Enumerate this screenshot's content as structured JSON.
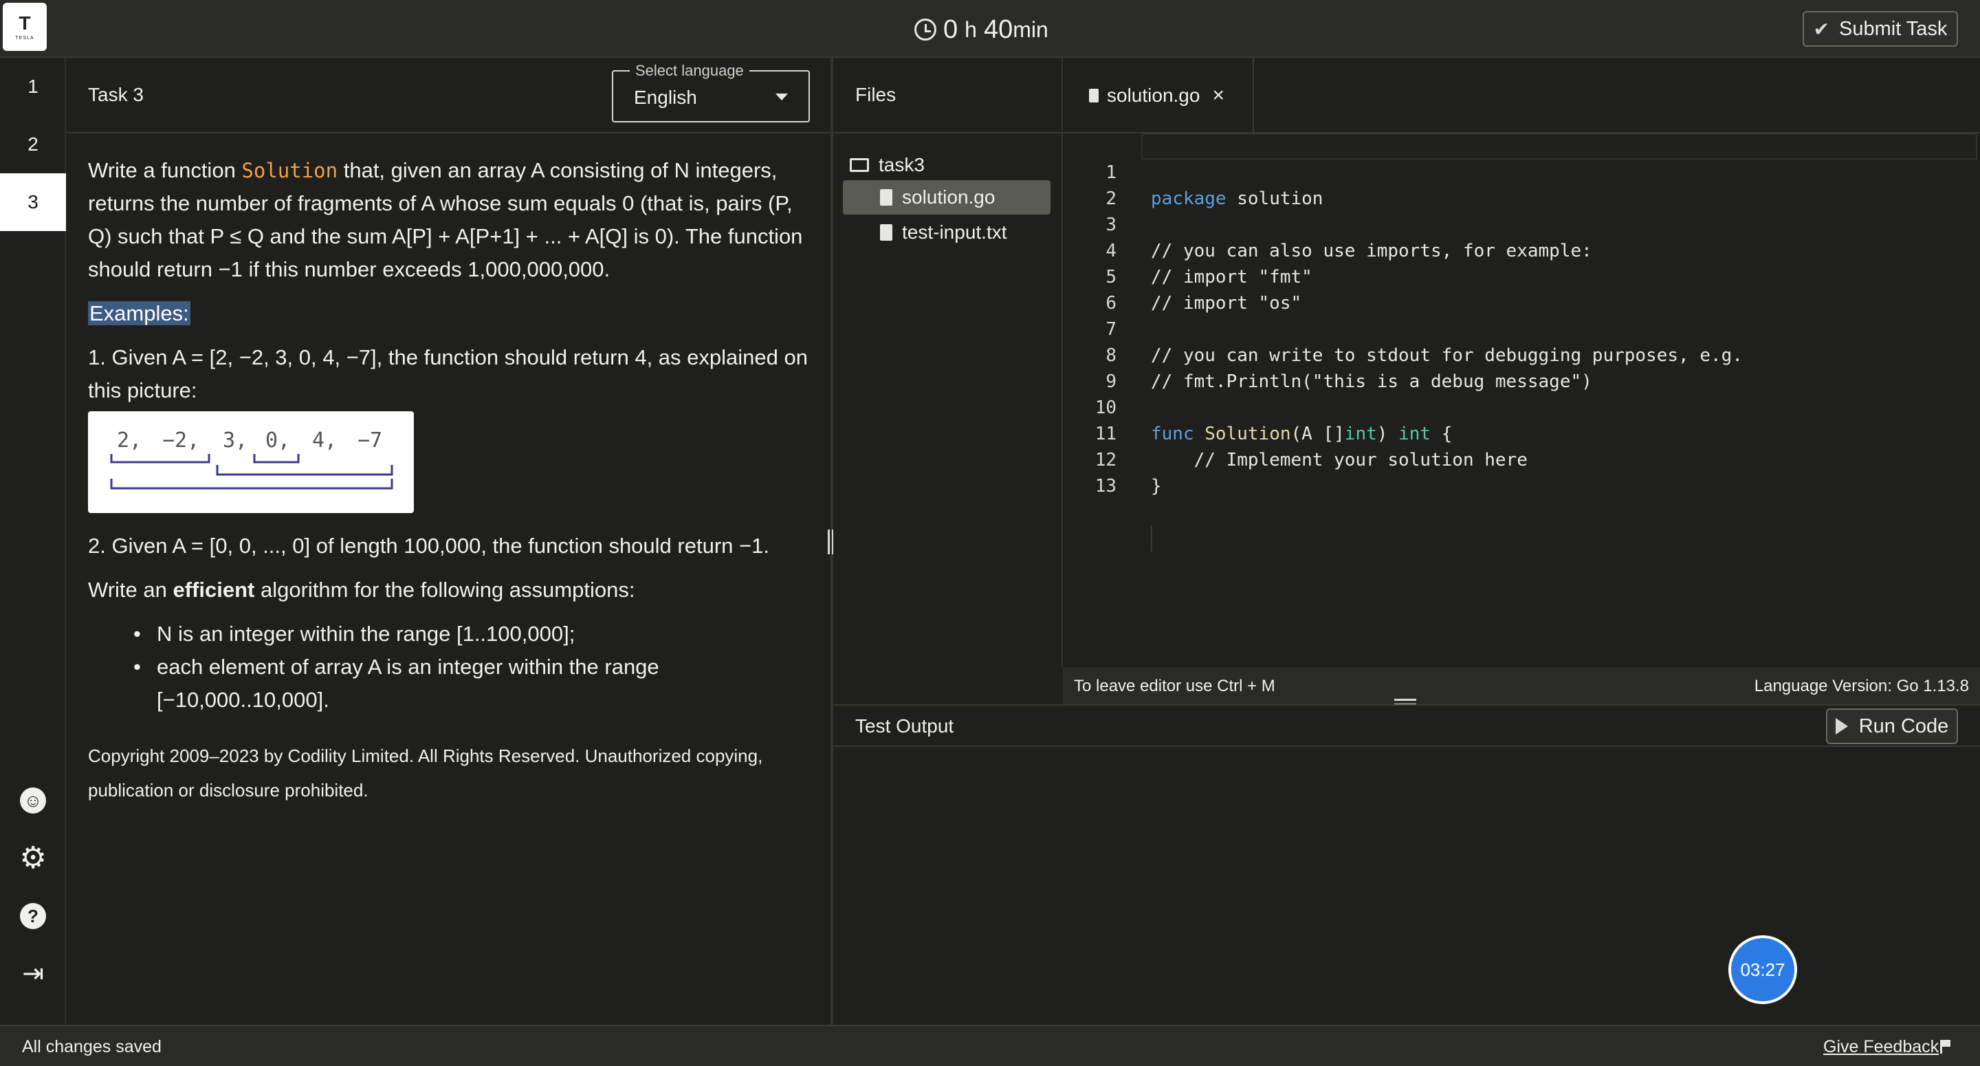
{
  "app": {
    "logo_text": "TESLA",
    "timer": {
      "hours": "0",
      "h_unit": "h",
      "minutes": "40",
      "m_unit": "min"
    },
    "submit_label": "Submit Task"
  },
  "nav": {
    "tasks": [
      "1",
      "2",
      "3"
    ],
    "active_task": "3",
    "icons": [
      "accessibility-icon",
      "gear-icon",
      "help-icon",
      "exit-icon"
    ],
    "help_glyph": "?"
  },
  "task": {
    "title": "Task 3",
    "language_legend": "Select language",
    "language_value": "English",
    "desc_part1": "Write a function ",
    "desc_code": "Solution",
    "desc_part2": " that, given an array A consisting of N integers, returns the number of fragments of A whose sum equals 0 (that is, pairs (P, Q) such that P ≤ Q and the sum A[P] + A[P+1] + ... + A[Q] is 0). The function should return −1 if this number exceeds 1,000,000,000.",
    "examples_label": "Examples:",
    "example1": "1. Given A = [2, −2, 3, 0, 4, −7], the function should return 4, as explained on this picture:",
    "picture_values": [
      "2,",
      "−2,",
      "3,",
      "0,",
      "4,",
      "−7"
    ],
    "example2": "2. Given A = [0, 0, ..., 0] of length 100,000, the function should return −1.",
    "efficient_prefix": "Write an ",
    "efficient_word": "efficient",
    "efficient_suffix": " algorithm for the following assumptions:",
    "assumptions": [
      "N is an integer within the range [1..100,000];",
      "each element of array A is an integer within the range [−10,000..10,000]."
    ],
    "copyright": "Copyright 2009–2023 by Codility Limited. All Rights Reserved. Unauthorized copying, publication or disclosure prohibited."
  },
  "files": {
    "header": "Files",
    "folder": "task3",
    "items": [
      "solution.go",
      "test-input.txt"
    ],
    "selected": "solution.go"
  },
  "editor": {
    "tab_label": "solution.go",
    "close_glyph": "×",
    "lines": [
      "package solution",
      "",
      "// you can also use imports, for example:",
      "// import \"fmt\"",
      "// import \"os\"",
      "",
      "// you can write to stdout for debugging purposes, e.g.",
      "// fmt.Println(\"this is a debug message\")",
      "",
      "func Solution(A []int) int {",
      "    // Implement your solution here",
      "}",
      ""
    ],
    "status_left": "To leave editor use Ctrl + M",
    "status_right": "Language Version: Go 1.13.8"
  },
  "output": {
    "title": "Test Output",
    "run_label": "Run Code",
    "countdown": "03:27"
  },
  "footer": {
    "saved": "All changes saved",
    "feedback": "Give Feedback"
  },
  "colors": {
    "background": "#1f1f1b",
    "keyword": "#5aa0e6",
    "comment": "#6a9955",
    "code_word": "#f0a04b",
    "countdown": "#2c7be5"
  }
}
